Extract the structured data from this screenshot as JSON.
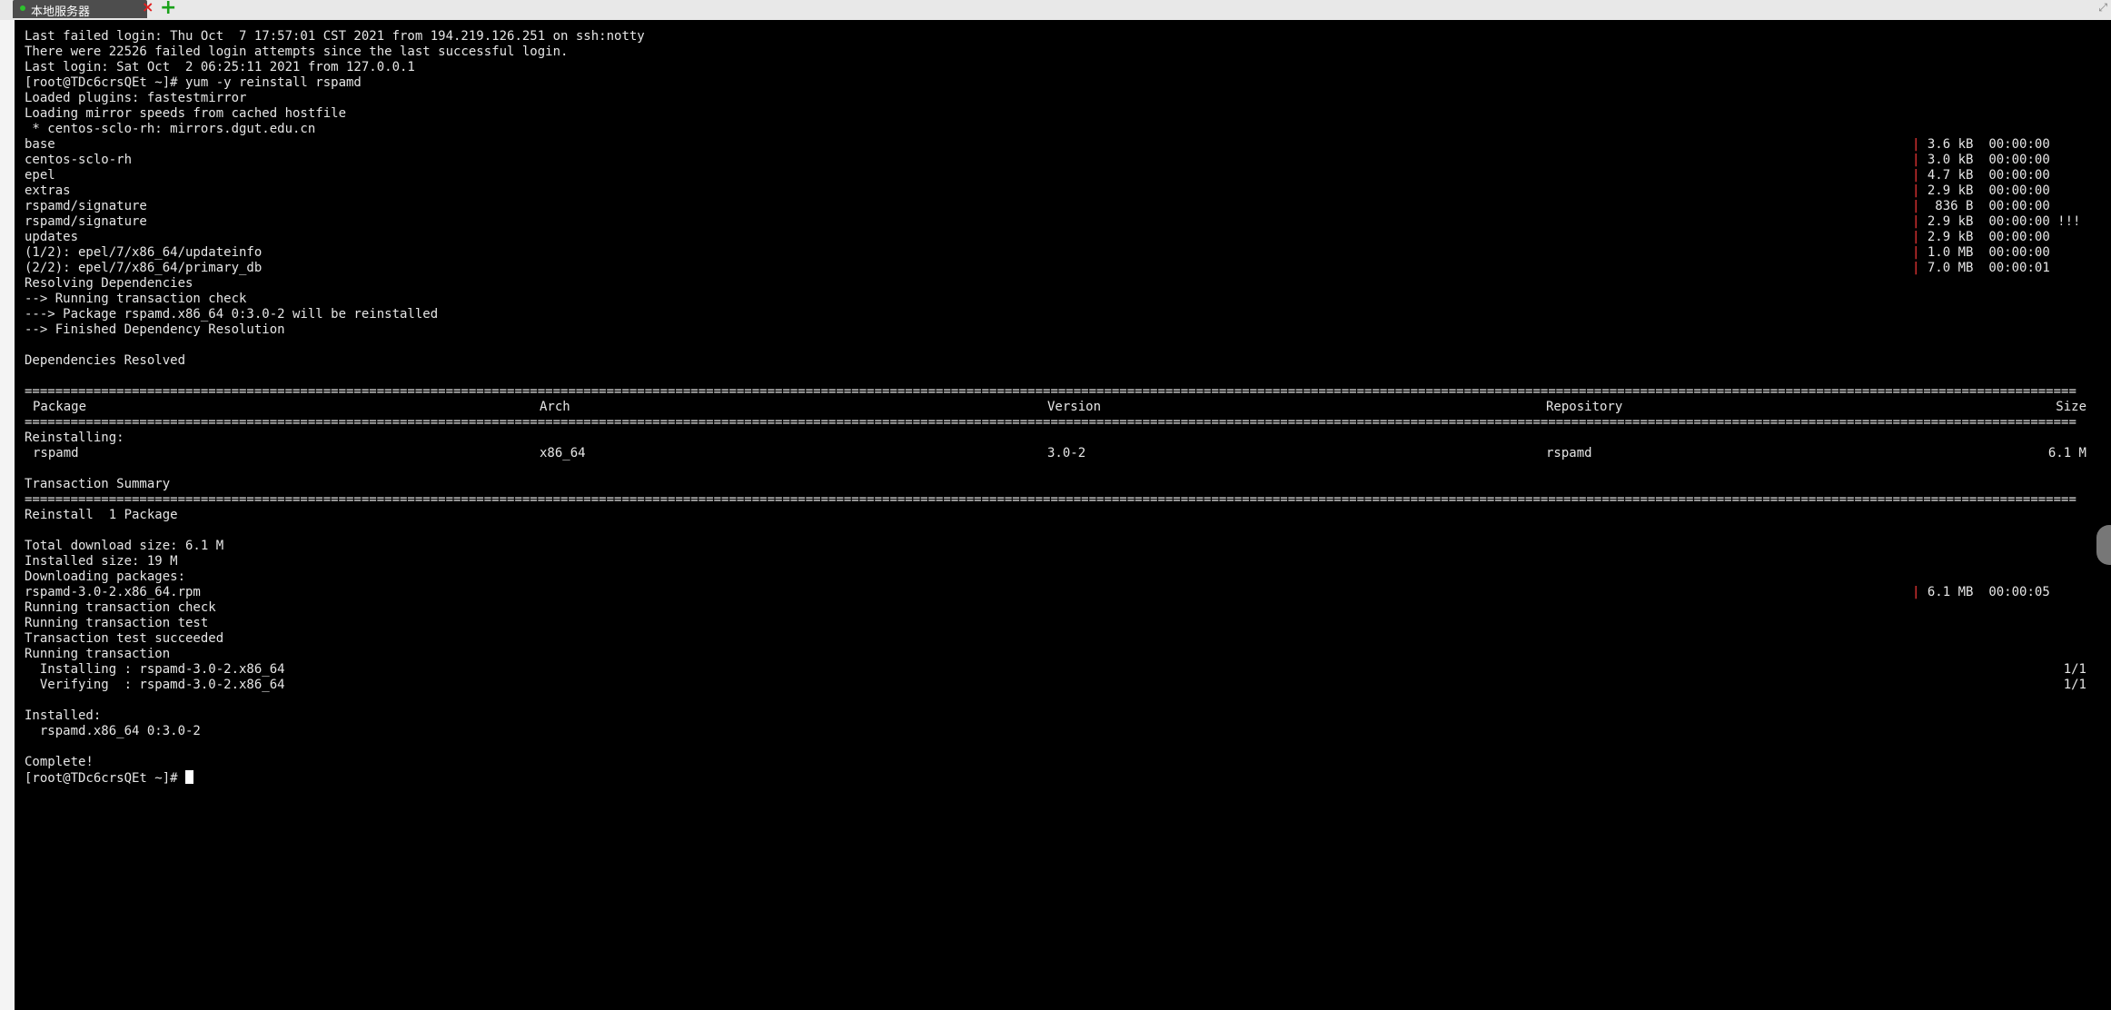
{
  "tabs": [
    {
      "label": "本地服务器",
      "status_color": "#2ec22e"
    }
  ],
  "terminal": {
    "lines_top": [
      "Last failed login: Thu Oct  7 17:57:01 CST 2021 from 194.219.126.251 on ssh:notty",
      "There were 22526 failed login attempts since the last successful login.",
      "Last login: Sat Oct  2 06:25:11 2021 from 127.0.0.1",
      "[root@TDc6crsQEt ~]# yum -y reinstall rspamd",
      "Loaded plugins: fastestmirror",
      "Loading mirror speeds from cached hostfile",
      " * centos-sclo-rh: mirrors.dgut.edu.cn"
    ],
    "repos": [
      {
        "name": "base",
        "size": " 3.6 kB",
        "time": "00:00:00"
      },
      {
        "name": "centos-sclo-rh",
        "size": " 3.0 kB",
        "time": "00:00:00"
      },
      {
        "name": "epel",
        "size": " 4.7 kB",
        "time": "00:00:00"
      },
      {
        "name": "extras",
        "size": " 2.9 kB",
        "time": "00:00:00"
      },
      {
        "name": "rspamd/signature",
        "size": "  836 B",
        "time": "00:00:00"
      },
      {
        "name": "rspamd/signature",
        "size": " 2.9 kB",
        "time": "00:00:00 !!!"
      },
      {
        "name": "updates",
        "size": " 2.9 kB",
        "time": "00:00:00"
      },
      {
        "name": "(1/2): epel/7/x86_64/updateinfo",
        "size": " 1.0 MB",
        "time": "00:00:00"
      },
      {
        "name": "(2/2): epel/7/x86_64/primary_db",
        "size": " 7.0 MB",
        "time": "00:00:01"
      }
    ],
    "deps_lines": [
      "Resolving Dependencies",
      "--> Running transaction check",
      "---> Package rspamd.x86_64 0:3.0-2 will be reinstalled",
      "--> Finished Dependency Resolution",
      "",
      "Dependencies Resolved",
      ""
    ],
    "table": {
      "headers": [
        "Package",
        "Arch",
        "Version",
        "Repository",
        "Size"
      ],
      "section": "Reinstalling:",
      "row": [
        "rspamd",
        "x86_64",
        "3.0-2",
        "rspamd",
        "6.1 M"
      ]
    },
    "summary_title": "Transaction Summary",
    "summary_line": "Reinstall  1 Package",
    "sizes_lines": [
      "Total download size: 6.1 M",
      "Installed size: 19 M",
      "Downloading packages:"
    ],
    "download": {
      "name": "rspamd-3.0-2.x86_64.rpm",
      "size": " 6.1 MB",
      "time": "00:00:05"
    },
    "run_lines": [
      "Running transaction check",
      "Running transaction test",
      "Transaction test succeeded",
      "Running transaction"
    ],
    "progress": [
      {
        "text": "  Installing : rspamd-3.0-2.x86_64",
        "count": "1/1"
      },
      {
        "text": "  Verifying  : rspamd-3.0-2.x86_64",
        "count": "1/1"
      }
    ],
    "installed_label": "Installed:",
    "installed_pkg": "  rspamd.x86_64 0:3.0-2",
    "complete": "Complete!",
    "prompt": "[root@TDc6crsQEt ~]# "
  }
}
